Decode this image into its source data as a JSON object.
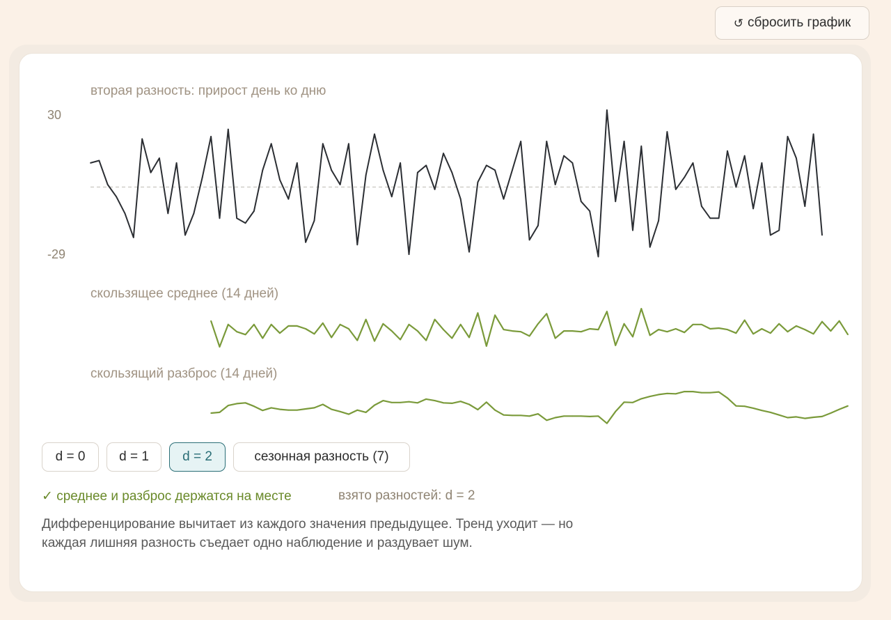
{
  "reset_button": {
    "icon": "reset-icon",
    "label": "сбросить график"
  },
  "chart_data": [
    {
      "type": "line",
      "title": "вторая разность: прирост день ко дню",
      "ylim": [
        -29,
        30
      ],
      "ytick_labels": [
        "30",
        "-29"
      ],
      "zero_line": true,
      "color": "#2b2e33",
      "values": [
        10,
        11,
        1,
        -4,
        -11,
        -21,
        20,
        6,
        12,
        -11,
        10,
        -20,
        -11,
        4,
        21,
        -13,
        24,
        -13,
        -15,
        -10,
        7,
        18,
        3,
        -5,
        10,
        -23,
        -14,
        18,
        7,
        1,
        18,
        -24,
        5,
        22,
        7,
        -4,
        10,
        -28,
        6,
        9,
        -1,
        14,
        6,
        -5,
        -27,
        2,
        9,
        7,
        -5,
        7,
        19,
        -22,
        -16,
        19,
        1,
        13,
        10,
        -6,
        -10,
        -29,
        32,
        -6,
        19,
        -18,
        17,
        -25,
        -14,
        23,
        -1,
        4,
        10,
        -8,
        -13,
        -13,
        15,
        0,
        13,
        -9,
        10,
        -20,
        -18,
        21,
        12,
        -8,
        22,
        -20
      ],
      "value_range": [
        -30,
        32
      ]
    },
    {
      "type": "line",
      "title": "скользящее среднее (14 дней)",
      "color": "#7a9a3a",
      "start_index": 14,
      "values": [
        0.5,
        -3.1,
        0.0,
        -1.0,
        -1.4,
        0.0,
        -1.9,
        0.0,
        -1.2,
        -0.2,
        -0.2,
        -0.6,
        -1.3,
        0.2,
        -1.8,
        0.0,
        -0.6,
        -2.2,
        0.7,
        -2.3,
        0.1,
        -0.9,
        -2.1,
        0.0,
        -0.9,
        -2.2,
        0.7,
        -0.7,
        -1.9,
        0.0,
        -1.8,
        1.6,
        -3.0,
        1.3,
        -0.7,
        -0.9,
        -1.0,
        -1.6,
        0.1,
        1.5,
        -1.9,
        -0.9,
        -0.9,
        -1.0,
        -0.6,
        -0.7,
        1.8,
        -2.9,
        0.1,
        -1.7,
        2.2,
        -1.5,
        -0.7,
        -1.0,
        -0.6,
        -1.1,
        0.0,
        0.0,
        -0.6,
        -0.5,
        -0.7,
        -1.2,
        0.6,
        -1.3,
        -0.6,
        -1.2,
        0.1,
        -1.0,
        -0.2,
        -0.7,
        -1.3,
        0.4,
        -0.9,
        0.5,
        -1.4
      ],
      "value_range": [
        -3.5,
        2.5
      ]
    },
    {
      "type": "line",
      "title": "скользящий разброс (14 дней)",
      "color": "#7a9a3a",
      "start_index": 14,
      "values": [
        13.0,
        13.2,
        15.0,
        15.5,
        15.7,
        14.8,
        13.7,
        14.4,
        14.0,
        13.8,
        13.8,
        14.1,
        14.4,
        15.3,
        14.0,
        13.4,
        12.7,
        13.8,
        13.2,
        15.1,
        16.3,
        15.8,
        15.8,
        16.0,
        15.7,
        16.7,
        16.3,
        15.7,
        15.6,
        16.1,
        15.3,
        13.9,
        15.9,
        13.8,
        12.5,
        12.4,
        12.4,
        12.2,
        12.8,
        11.1,
        11.8,
        12.2,
        12.2,
        12.2,
        12.1,
        12.2,
        10.3,
        13.4,
        15.9,
        15.8,
        16.8,
        17.4,
        17.9,
        18.2,
        18.1,
        18.7,
        18.7,
        18.4,
        18.4,
        18.6,
        17.0,
        14.9,
        14.8,
        14.3,
        13.7,
        13.2,
        12.5,
        11.8,
        12.0,
        11.6,
        11.9,
        12.1,
        13.0,
        14.0,
        14.9
      ],
      "value_range": [
        9.5,
        20
      ]
    }
  ],
  "chips": [
    {
      "label": "d = 0",
      "active": false
    },
    {
      "label": "d = 1",
      "active": false
    },
    {
      "label": "d = 2",
      "active": true
    },
    {
      "label": "сезонная разность (7)",
      "active": false
    }
  ],
  "status": {
    "ok": "✓ среднее и разброс держатся на месте",
    "d_text": "взято разностей: d = 2"
  },
  "description": "Дифференцирование вычитает из каждого значения предыдущее. Тренд уходит — но каждая лишняя разность съедает одно наблюдение и раздувает шум."
}
